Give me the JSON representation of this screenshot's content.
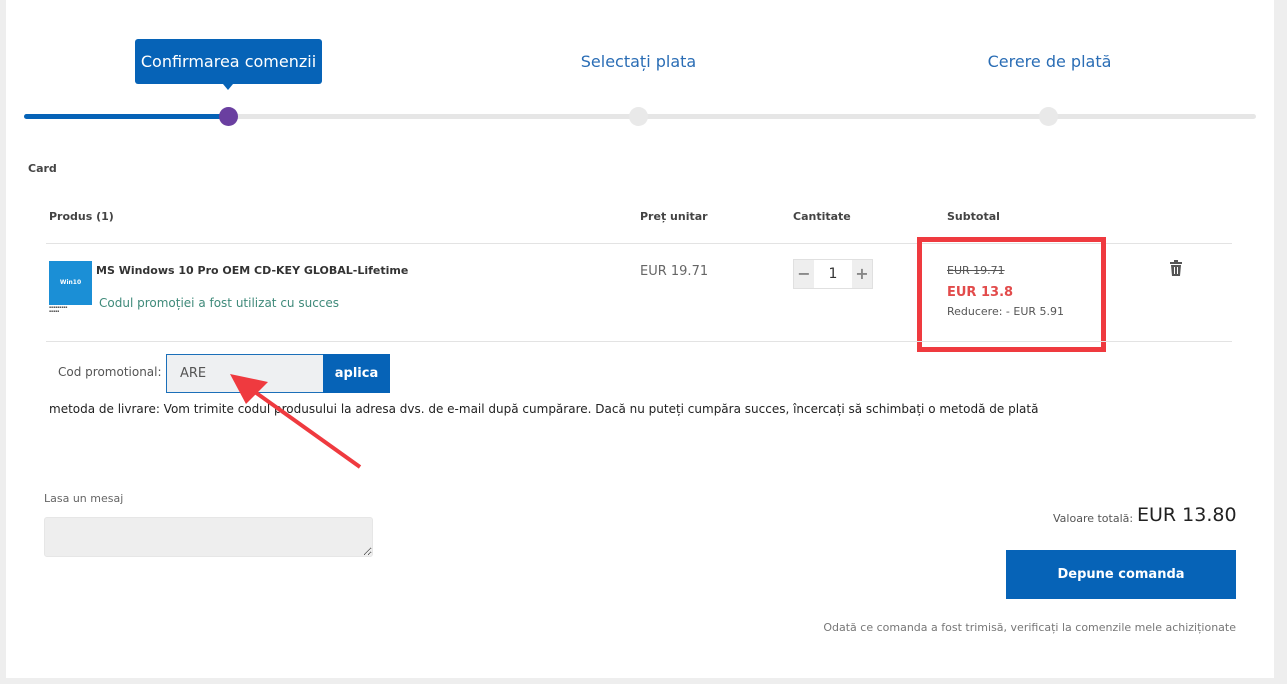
{
  "steps": [
    {
      "label": "Confirmarea comenzii",
      "active": true
    },
    {
      "label": "Selectați plata",
      "active": false
    },
    {
      "label": "Cerere de plată",
      "active": false
    }
  ],
  "progress": {
    "completed_steps": 1,
    "total_steps": 3
  },
  "cart": {
    "section_title": "Card",
    "columns": {
      "product": "Produs (1)",
      "unit_price": "Preț unitar",
      "quantity": "Cantitate",
      "subtotal": "Subtotal"
    },
    "item": {
      "name": "MS Windows 10 Pro OEM CD-KEY GLOBAL-Lifetime",
      "image_text": "Win10",
      "promo_message": "Codul promoției a fost utilizat cu succes",
      "unit_price": "EUR 19.71",
      "quantity": "1",
      "minus": "−",
      "plus": "+",
      "old_price": "EUR 19.71",
      "new_price": "EUR 13.8",
      "discount": "Reducere: - EUR 5.91"
    }
  },
  "promo": {
    "label": "Cod promotional:",
    "value": "ARE",
    "apply_label": "aplica"
  },
  "delivery_text": "metoda de livrare: Vom trimite codul produsului la adresa dvs. de e-mail după cumpărare. Dacă nu puteți cumpăra succes, încercați să schimbați o metodă de plată",
  "message": {
    "label": "Lasa un mesaj",
    "value": ""
  },
  "total": {
    "label": "Valoare totală:",
    "value": "EUR 13.80"
  },
  "submit_label": "Depune comanda",
  "footnote": "Odată ce comanda a fost trimisă, verificați la comenzile mele achiziționate",
  "colors": {
    "primary": "#0663b7",
    "highlight": "#ef3a3f",
    "discount_price": "#e24b4b",
    "success_text": "#3f8a7a",
    "active_dot": "#6a3fa0"
  },
  "icons": [
    "trash-icon",
    "arrow-annotation"
  ]
}
